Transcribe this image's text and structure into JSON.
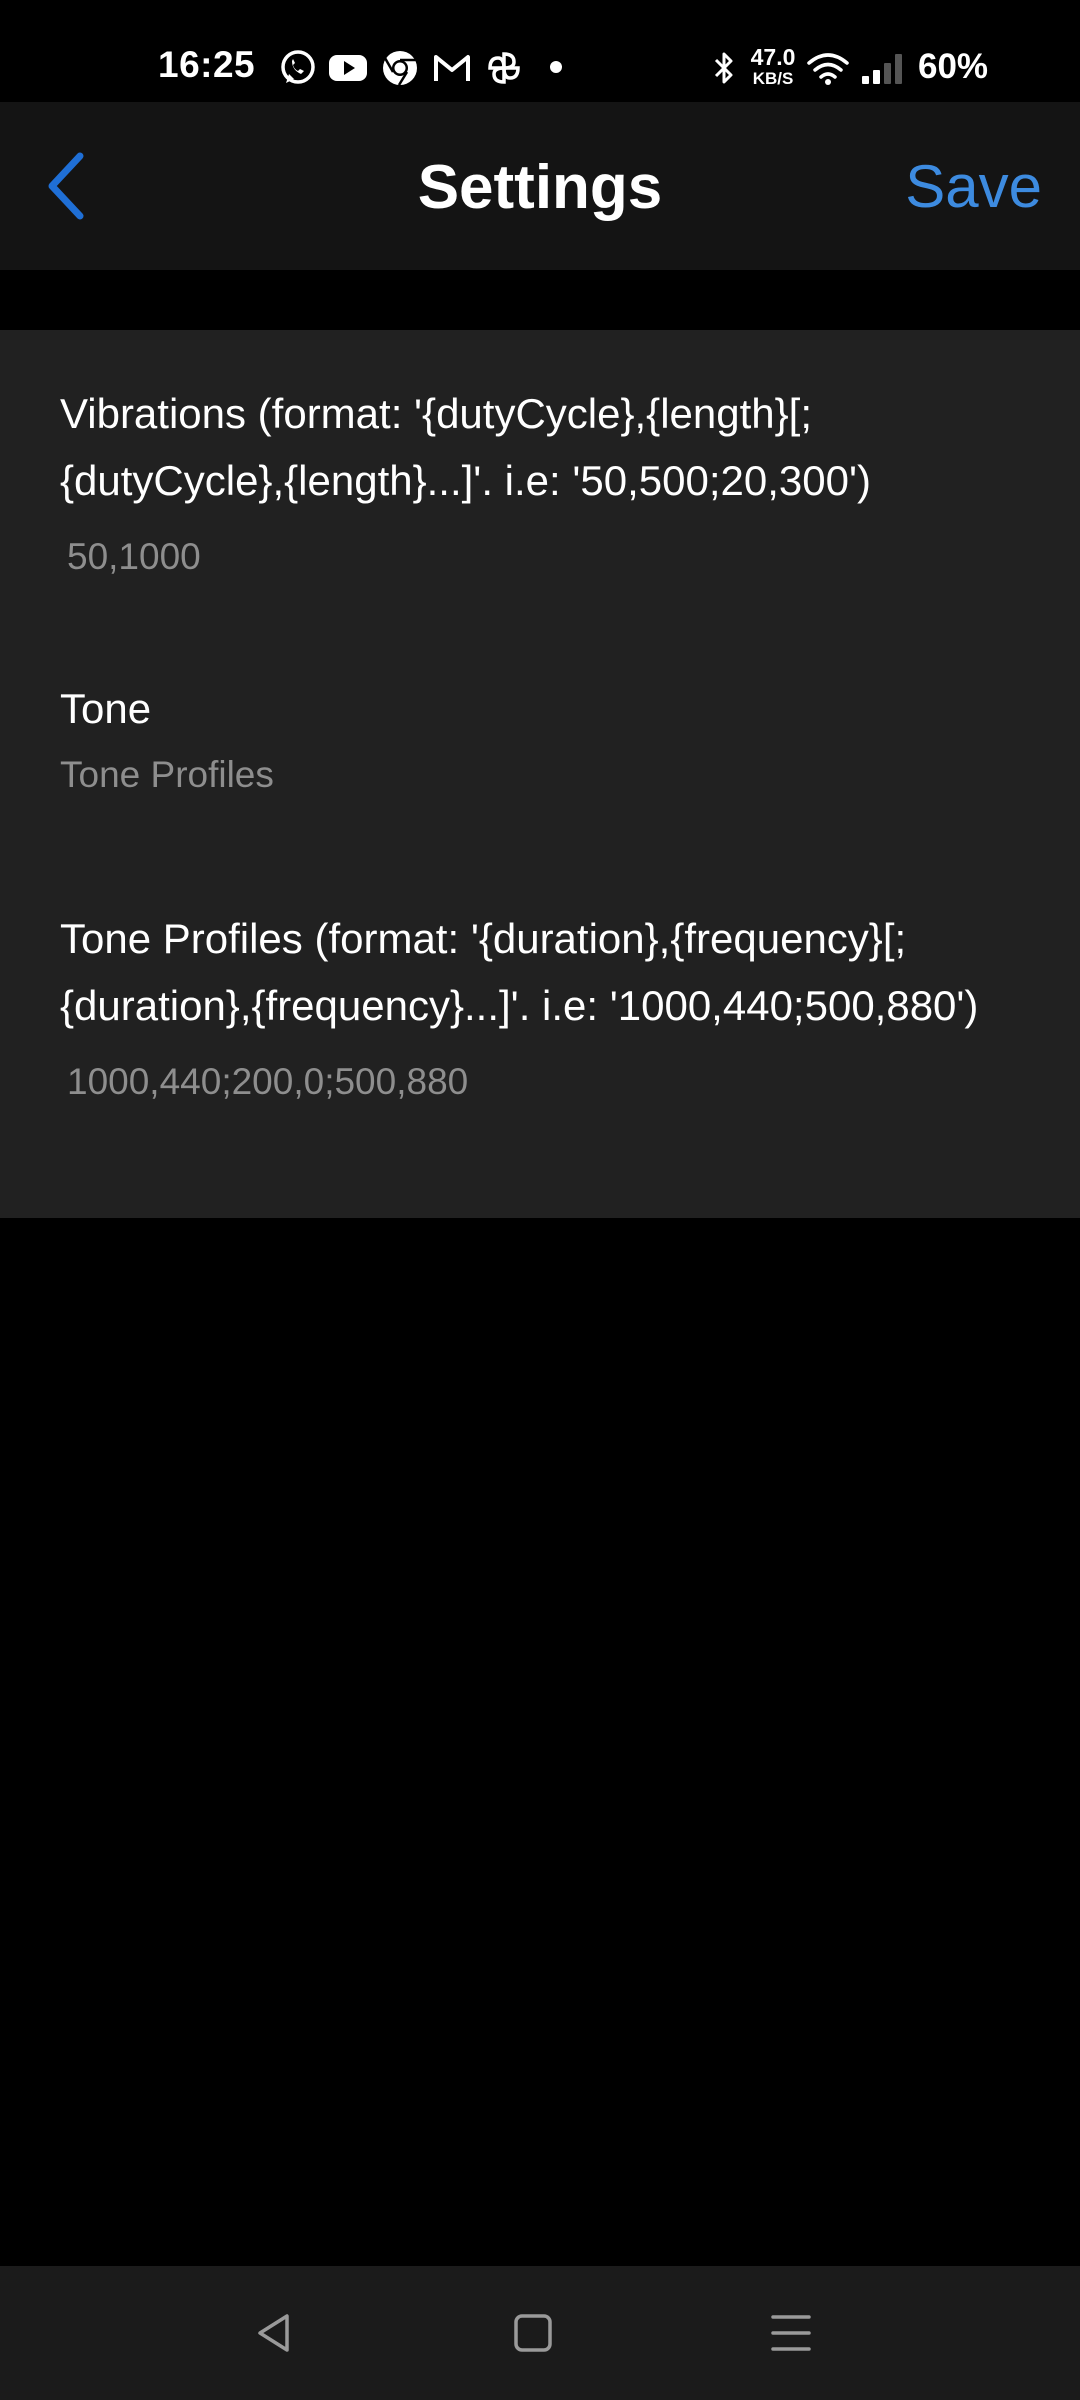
{
  "status_bar": {
    "time": "16:25",
    "notification_icons": [
      "whatsapp-icon",
      "youtube-icon",
      "chrome-icon",
      "gmail-icon",
      "pinwheel-icon",
      "more-dot-icon"
    ],
    "network_speed_value": "47.0",
    "network_speed_unit": "KB/S",
    "battery": "60%",
    "system_icons": [
      "bluetooth-icon",
      "wifi-icon",
      "cellular-signal-icon"
    ]
  },
  "app_bar": {
    "title": "Settings",
    "save_label": "Save",
    "back_icon": "chevron-left-icon",
    "accent_color": "#3d8be0"
  },
  "settings": {
    "items": [
      {
        "title": "Vibrations (format: '{dutyCycle},{length}[;{dutyCycle},{length}...]'. i.e: '50,500;20,300')",
        "value": "50,1000"
      },
      {
        "title": "Tone",
        "value": "Tone Profiles"
      },
      {
        "title": "Tone Profiles (format: '{duration},{frequency}[;{duration},{frequency}...]'. i.e: '1000,440;500,880')",
        "value": "1000,440;200,0;500,880"
      }
    ]
  },
  "nav_bar": {
    "buttons": [
      "back-triangle-icon",
      "home-square-icon",
      "recents-menu-icon"
    ]
  },
  "colors": {
    "background": "#000000",
    "app_bar": "#141414",
    "panel": "#212121",
    "secondary_text": "#8e8e8e"
  }
}
